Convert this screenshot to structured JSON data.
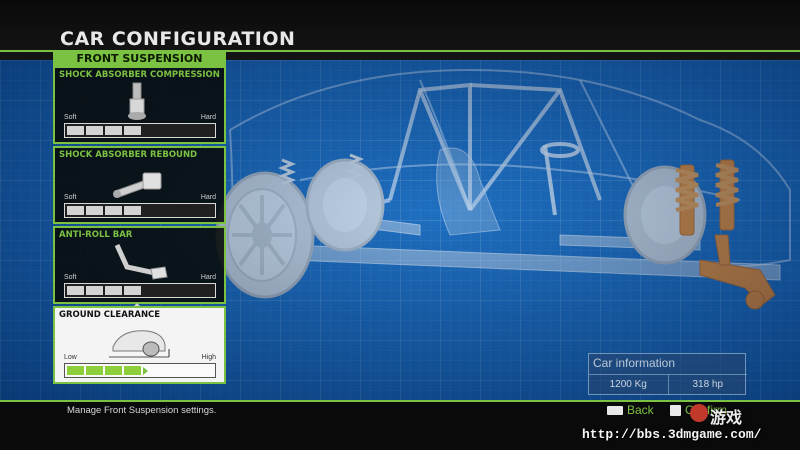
{
  "header": {
    "title": "CAR CONFIGURATION"
  },
  "panel": {
    "title": "FRONT SUSPENSION",
    "sections": [
      {
        "label": "SHOCK ABSORBER COMPRESSION",
        "icon": "shock-absorber-icon",
        "min_label": "Soft",
        "max_label": "Hard",
        "level": 4,
        "max": 8,
        "selected": false
      },
      {
        "label": "SHOCK ABSORBER REBOUND",
        "icon": "rebound-arm-icon",
        "min_label": "Soft",
        "max_label": "Hard",
        "level": 4,
        "max": 8,
        "selected": false
      },
      {
        "label": "ANTI-ROLL BAR",
        "icon": "anti-roll-bar-icon",
        "min_label": "Soft",
        "max_label": "Hard",
        "level": 4,
        "max": 8,
        "selected": false
      },
      {
        "label": "GROUND CLEARANCE",
        "icon": "ground-clearance-icon",
        "min_label": "Low",
        "max_label": "High",
        "level": 4,
        "max": 8,
        "selected": true
      }
    ]
  },
  "car_info": {
    "title": "Car information",
    "weight": "1200 Kg",
    "power": "318 hp"
  },
  "footer": {
    "help": "Manage Front Suspension settings.",
    "back_label": "Back",
    "confirm_label": "Confirm"
  },
  "watermark": {
    "url": "http://bbs.3dmgame.com/",
    "logo": "游戏"
  },
  "colors": {
    "accent": "#7bc142",
    "blueprint": "#1566b8",
    "highlight_part": "#f08a24"
  }
}
